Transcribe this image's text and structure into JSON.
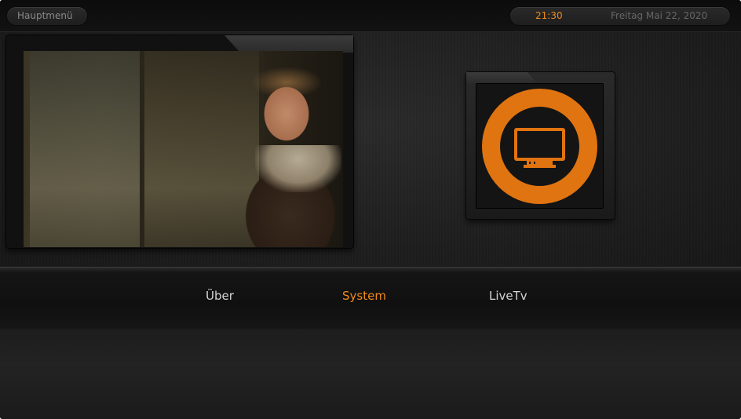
{
  "topbar": {
    "menu_label": "Hauptmenü",
    "time": "21:30",
    "date": "Freitag Mai 22, 2020"
  },
  "tile": {
    "icon": "monitor-icon",
    "accent_color": "#e07410"
  },
  "main_menu": {
    "items": [
      {
        "label": "Über",
        "active": false
      },
      {
        "label": "System",
        "active": true
      },
      {
        "label": "LiveTv",
        "active": false
      }
    ],
    "active_color": "#f08a1a"
  }
}
